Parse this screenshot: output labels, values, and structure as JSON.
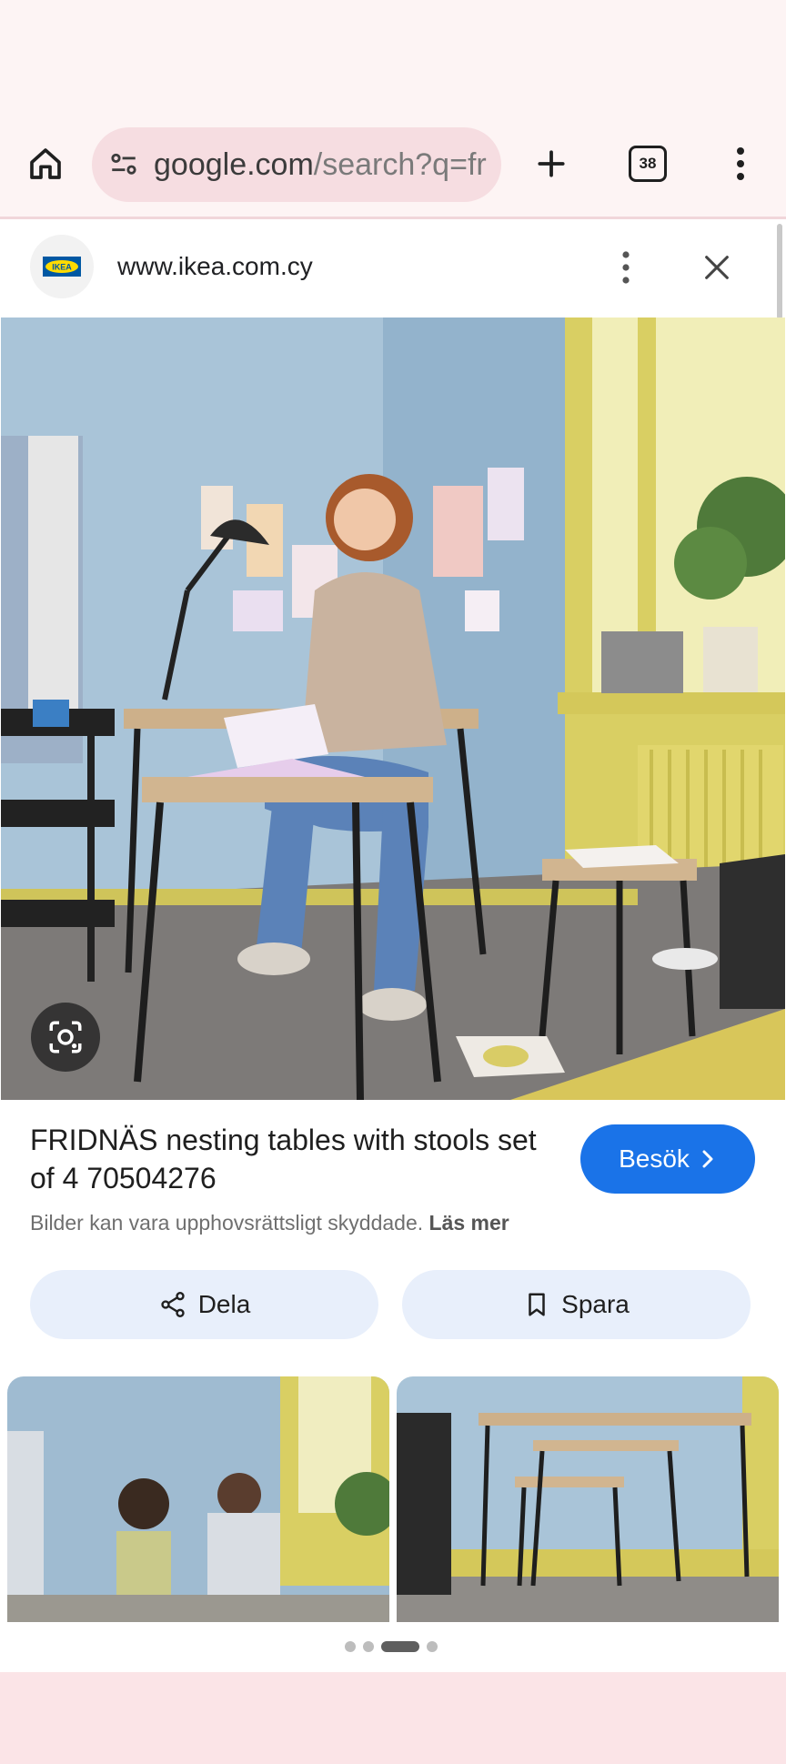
{
  "browser": {
    "url_host": "google.com",
    "url_rest": "/search?q=fr",
    "tab_count": "38"
  },
  "panel": {
    "site_url": "www.ikea.com.cy",
    "logo_text": "IKEA",
    "product_title": "FRIDNÄS nesting tables with stools set of 4 70504276",
    "visit_label": "Besök",
    "copyright_text": "Bilder kan vara upphovsrättsligt skyddade.",
    "read_more": "Läs mer",
    "share_label": "Dela",
    "save_label": "Spara"
  },
  "carousel": {
    "page_count": 4,
    "active_index": 2
  },
  "colors": {
    "accent_blue": "#1a73e8",
    "omnibox_bg": "#f6dde1",
    "pill_bg": "#e8effb"
  },
  "icons": [
    "home-icon",
    "site-tune-icon",
    "plus-icon",
    "tab-switcher-icon",
    "more-vert-icon",
    "close-icon",
    "google-lens-icon",
    "share-icon",
    "bookmark-icon",
    "chevron-right-icon"
  ]
}
